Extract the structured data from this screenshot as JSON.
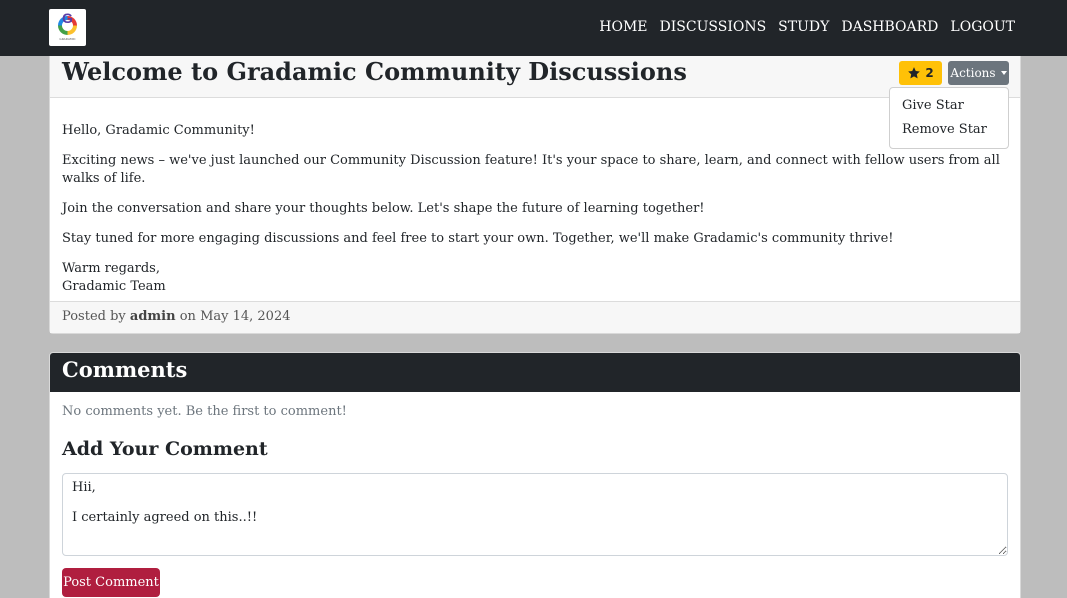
{
  "nav": {
    "logo_letter": "G",
    "logo_tagline": "GRADAMIC",
    "links": [
      "HOME",
      "DISCUSSIONS",
      "STUDY",
      "DASHBOARD",
      "LOGOUT"
    ]
  },
  "post": {
    "title": "Welcome to Gradamic Community Discussions",
    "star_count": "2",
    "actions_label": "Actions",
    "dropdown": [
      "Give Star",
      "Remove Star"
    ],
    "paragraphs": [
      "Hello, Gradamic Community!",
      "Exciting news – we've just launched our Community Discussion feature! It's your space to share, learn, and connect with fellow users from all walks of life.",
      "Join the conversation and share your thoughts below. Let's shape the future of learning together!",
      "Stay tuned for more engaging discussions and feel free to start your own. Together, we'll make Gradamic's community thrive!"
    ],
    "signoff_line1": "Warm regards,",
    "signoff_line2": "Gradamic Team",
    "footer_prefix": "Posted by",
    "author": "admin",
    "footer_on": "on",
    "date": "May 14, 2024"
  },
  "comments": {
    "title": "Comments",
    "empty_text": "No comments yet. Be the first to comment!",
    "add_title": "Add Your Comment",
    "comment_value": "Hii,\n\nI certainly agreed on this..!!",
    "post_button": "Post Comment"
  },
  "colors": {
    "navbar": "#212529",
    "star_button": "#ffc107",
    "actions_button": "#6c757d",
    "post_button": "#b01e3f"
  }
}
